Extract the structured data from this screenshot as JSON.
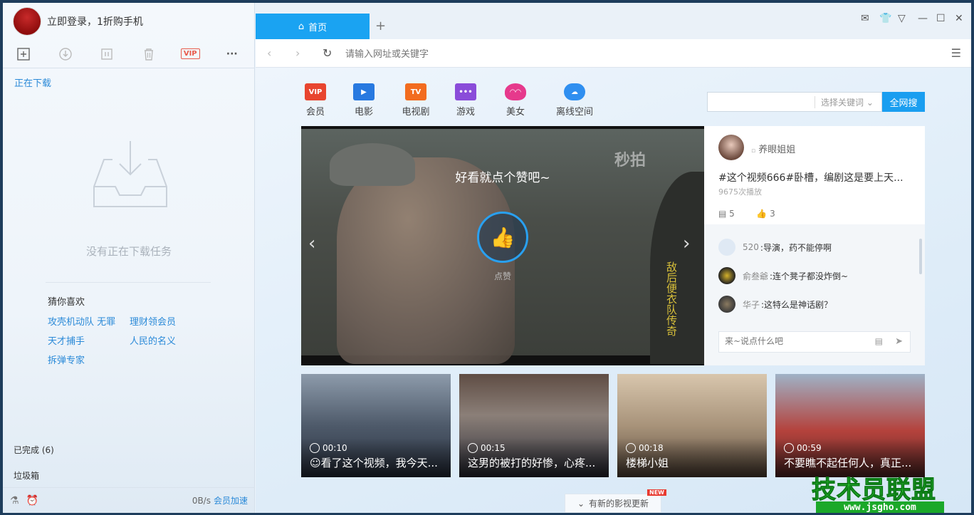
{
  "left": {
    "login_text": "立即登录，1折购手机",
    "vip_label": "VIP",
    "more_label": "···",
    "downloading": "正在下载",
    "empty_text": "没有正在下载任务",
    "guess_title": "猜你喜欢",
    "guess_items": [
      "攻壳机动队 无罪",
      "理财领会员",
      "天才捕手",
      "人民的名义",
      "拆弹专家"
    ],
    "completed": "已完成 (6)",
    "trash": "垃圾箱",
    "speed": "0B/s",
    "speed_up": "会员加速"
  },
  "browser": {
    "tab_label": "首页",
    "tab_add": "+",
    "address_placeholder": "请输入网址或关键字"
  },
  "categories": [
    {
      "label": "会员",
      "icon": "VIP",
      "color": "#e8452f"
    },
    {
      "label": "电影",
      "icon": "▶",
      "color": "#2879e0"
    },
    {
      "label": "电视剧",
      "icon": "TV",
      "color": "#f26c1f"
    },
    {
      "label": "游戏",
      "icon": "•••",
      "color": "#8a4cd9"
    },
    {
      "label": "美女",
      "icon": "",
      "color": "#e6398c"
    },
    {
      "label": "离线空间",
      "icon": "",
      "color": "#2f8ff0"
    }
  ],
  "search": {
    "select_label": "选择关键词",
    "button": "全网搜"
  },
  "video": {
    "overlay": "好看就点个赞吧~",
    "like_label": "点赞",
    "watermark": "秒拍",
    "vertical_text": "敌后便衣队传奇"
  },
  "side": {
    "author": "养眼姐姐",
    "title": "#这个视频666#卧槽，编剧这是要上天...",
    "plays": "9675次播放",
    "comment_count": "5",
    "like_count": "3",
    "comments": [
      {
        "name": "520",
        "text": ":导演，药不能停啊"
      },
      {
        "name": "俞叁爺",
        "text": ":连个凳子都没炸倒~"
      },
      {
        "name": "华子",
        "text": ":这特么是神话剧？"
      }
    ],
    "comment_placeholder": "来~说点什么吧"
  },
  "thumbs": [
    {
      "duration": "00:10",
      "title": "☺看了这个视频，我今天..."
    },
    {
      "duration": "00:15",
      "title": "这男的被打的好惨，心疼..."
    },
    {
      "duration": "00:18",
      "title": "楼梯小姐"
    },
    {
      "duration": "00:59",
      "title": "不要瞧不起任何人，真正..."
    }
  ],
  "update_bar": "有新的影视更新",
  "new_badge": "NEW",
  "site_logo": {
    "name": "技术员联盟",
    "url": "www.jsgho.com"
  }
}
